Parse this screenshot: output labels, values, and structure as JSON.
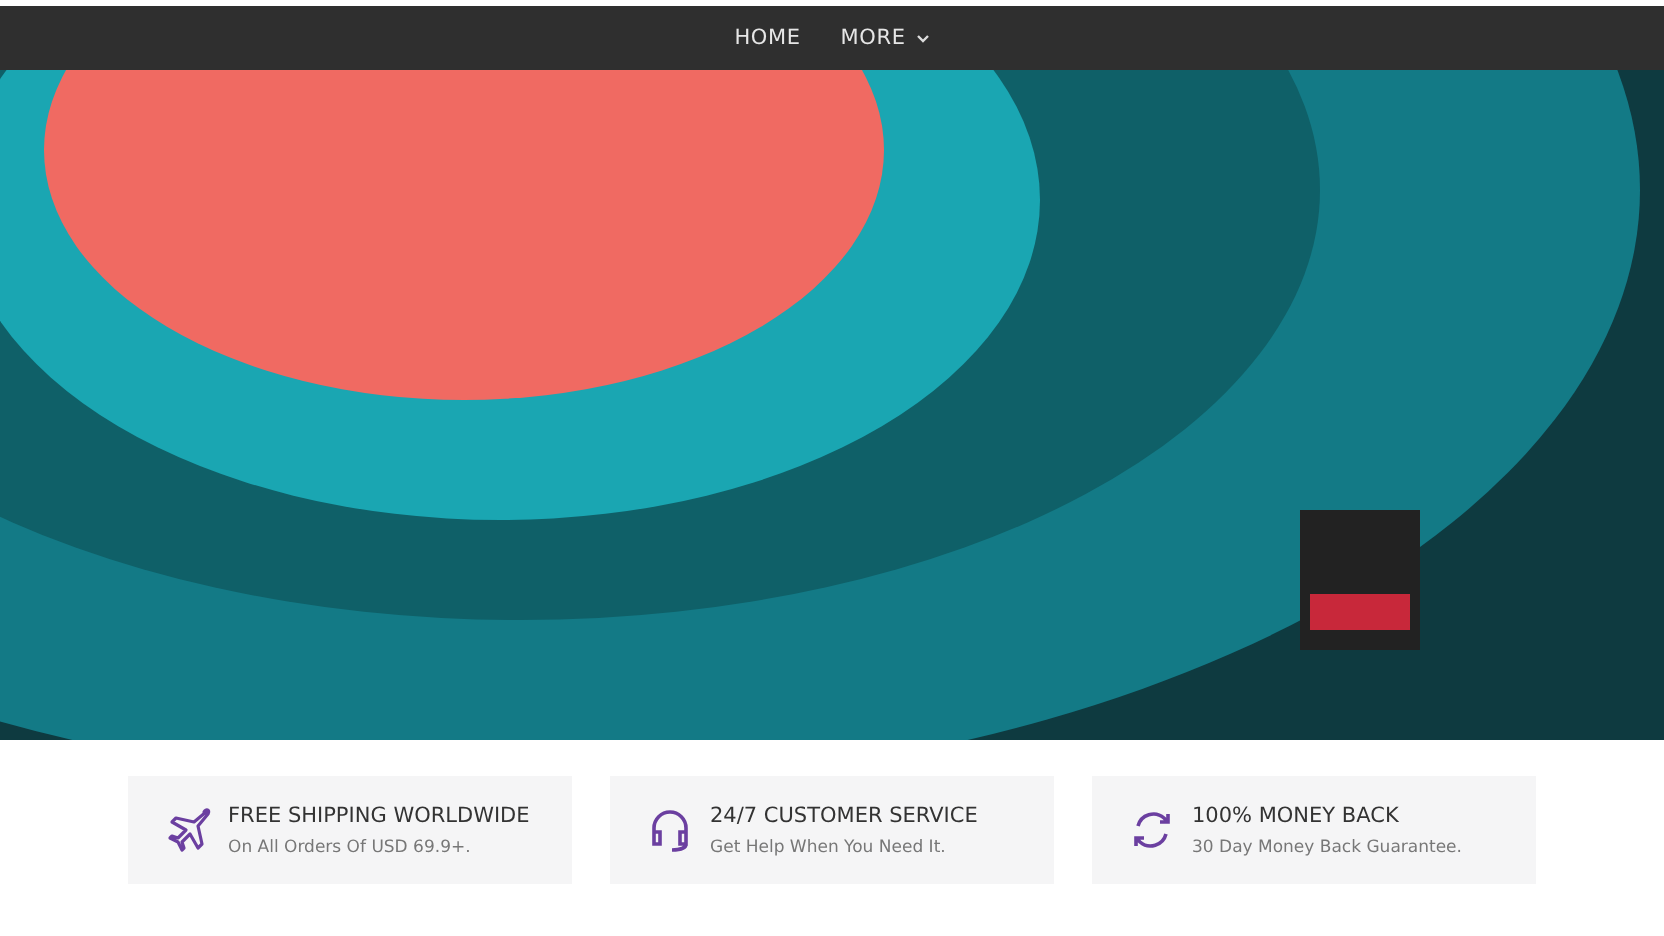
{
  "nav": {
    "items": [
      {
        "label": "HOME",
        "dropdown": false
      },
      {
        "label": "MORE",
        "dropdown": true
      }
    ]
  },
  "features": [
    {
      "kind": "plane",
      "title": "FREE SHIPPING WORLDWIDE",
      "text": "On All Orders Of USD 69.9+."
    },
    {
      "kind": "headset",
      "title": "24/7 CUSTOMER SERVICE",
      "text": "Get Help When You Need It."
    },
    {
      "kind": "refresh",
      "title": "100% MONEY BACK",
      "text": "30 Day Money Back Guarantee."
    }
  ]
}
